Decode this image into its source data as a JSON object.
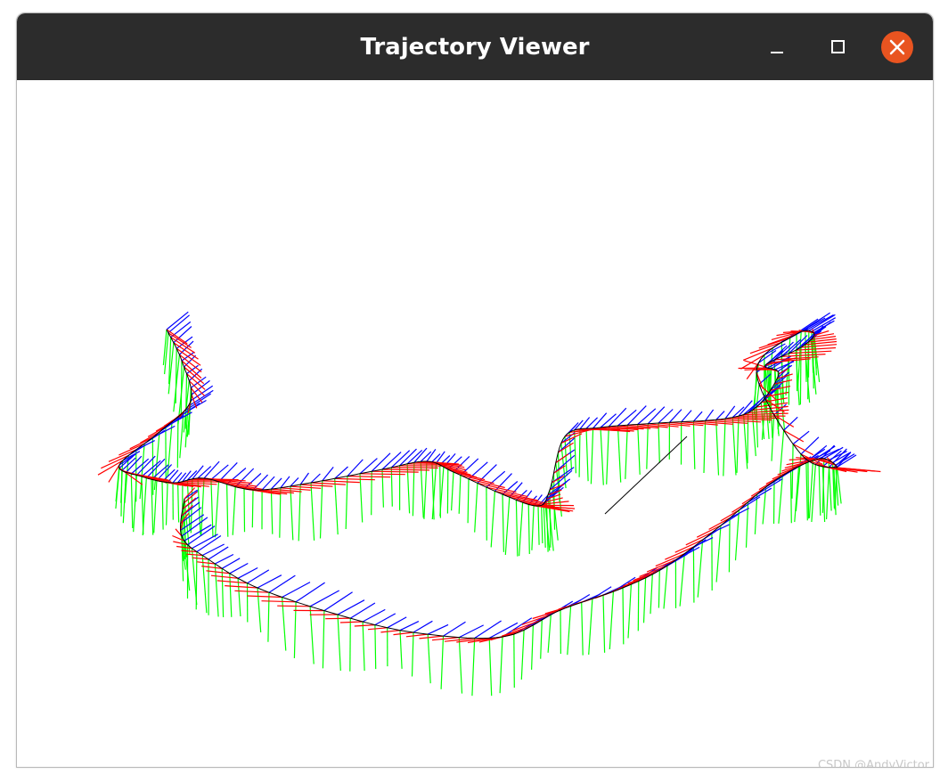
{
  "window": {
    "title": "Trajectory Viewer",
    "controls": [
      {
        "name": "minimize",
        "icon": "minimize-icon"
      },
      {
        "name": "maximize",
        "icon": "maximize-icon"
      },
      {
        "name": "close",
        "icon": "close-icon",
        "color": "#e95420"
      }
    ],
    "titlebar_color": "#2c2c2c"
  },
  "viewer": {
    "background": "#ffffff",
    "trajectory_color": "#000000",
    "axis_colors": {
      "x": "#ff0000",
      "y": "#00ff00",
      "z": "#0000ff"
    }
  },
  "watermark": "CSDN @AndyVictor"
}
